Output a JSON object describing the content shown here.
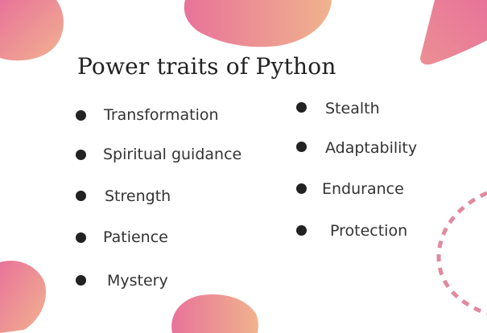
{
  "title": "Power traits of Python",
  "traits": {
    "left": [
      "Transformation",
      "Spiritual guidance",
      "Strength",
      "Patience",
      "Mystery"
    ],
    "right": [
      "Stealth",
      "Adaptability",
      "Endurance",
      "Protection"
    ]
  },
  "colors": {
    "blob_pink": "#e8739a",
    "blob_peach": "#f0b090",
    "dash_arc": "#e08aa0",
    "text": "#333333",
    "bullet": "#222222"
  }
}
